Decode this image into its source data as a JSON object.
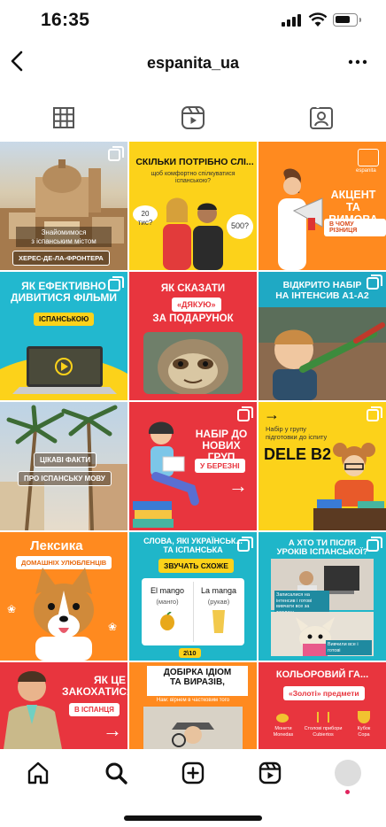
{
  "status": {
    "time": "16:35"
  },
  "header": {
    "username": "espanita_ua"
  },
  "tabs": [
    "grid",
    "reels",
    "tagged"
  ],
  "posts": {
    "p1": {
      "line1": "Знайомимося",
      "line2": "з іспанським містом",
      "pill": "ХЕРЕС-ДЕ-ЛА-ФРОНТЕРА"
    },
    "p2": {
      "title": "СКІЛЬКИ ПОТРІБНО СЛІ...",
      "sub": "щоб комфортно спілкуватися іспанською?",
      "b1": "20 тис?",
      "b2": "500?"
    },
    "p3": {
      "t1": "АКЦЕНТ ТА",
      "t2": "ВИМОВА",
      "pill": "В ЧОМУ РІЗНИЦЯ",
      "brand": "espanita"
    },
    "p4": {
      "t1": "ЯК ЕФЕКТИВНО",
      "t2": "ДИВИТИСЯ ФІЛЬМИ",
      "pill": "ІСПАНСЬКОЮ"
    },
    "p5": {
      "t1": "ЯК СКАЗАТИ",
      "pill": "«ДЯКУЮ»",
      "t2": "ЗА ПОДАРУНОК"
    },
    "p6": {
      "t1": "ВІДКРИТО НАБІР",
      "t2": "НА ІНТЕНСИВ А1-А2"
    },
    "p7": {
      "pill1": "ЦІКАВІ ФАКТИ",
      "pill2": "ПРО ІСПАНСЬКУ МОВУ"
    },
    "p8": {
      "t1": "НАБІР ДО",
      "t2": "НОВИХ ГРУП",
      "pill": "У БЕРЕЗНІ"
    },
    "p9": {
      "sub1": "Набір у групу",
      "sub2": "підготовки до іспиту",
      "title": "DELE B2"
    },
    "p10": {
      "title": "Лексика",
      "pill": "ДОМАШНІХ УЛЮБЛЕНЦІВ"
    },
    "p11": {
      "t1": "СЛОВА, ЯКІ УКРАЇНСЬК...",
      "t2": "ТА ІСПАНСЬКА",
      "pill": "ЗВУЧАТЬ СХОЖЕ",
      "w1": "El mango",
      "w1s": "(манго)",
      "w2": "La manga",
      "w2s": "(рукав)",
      "page": "2\\10"
    },
    "p12": {
      "t1": "А ХТО ТИ ПІСЛЯ",
      "t2": "УРОКІВ ІСПАНСЬКОЇ?",
      "c1": "Записалися на інтенсив і готові вивчати все за тиждень",
      "c2": "Вивчили все і готові"
    },
    "p13": {
      "t1": "ЯК ЦЕ",
      "t2": "ЗАКОХАТИСЯ",
      "pill": "В ІСПАНЦЯ"
    },
    "p14": {
      "t1": "ДОБІРКА ІДІОМ",
      "t2": "ТА ВИРАЗІВ,",
      "sub": "Нам: вірнем в частковим того"
    },
    "p15": {
      "t1": "КОЛЬОРОВИЙ ГА...",
      "pill": "«Золоті» предмети",
      "i1": "Монети",
      "i1s": "Monedas",
      "i2": "Столові прибори",
      "i2s": "Cubiertos",
      "i3": "Кубок",
      "i3s": "Copa"
    }
  }
}
